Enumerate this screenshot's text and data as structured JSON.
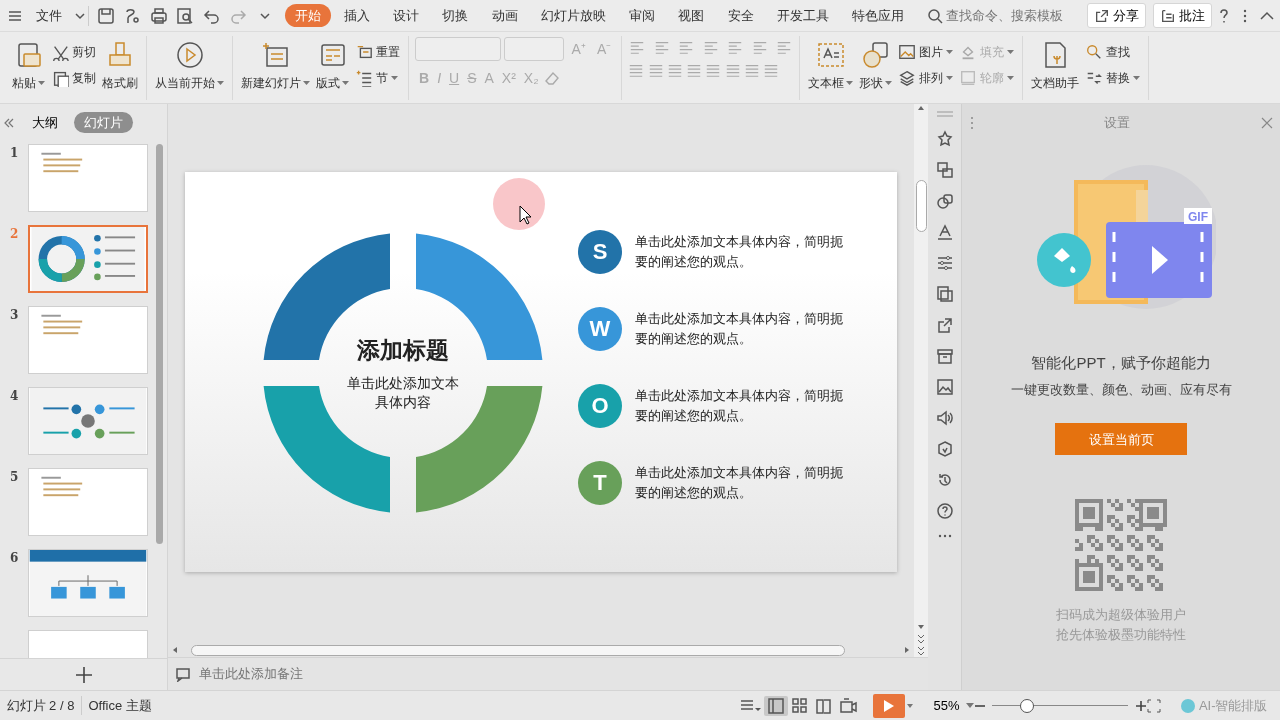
{
  "file_menu": "文件",
  "tabs": [
    {
      "label": "开始",
      "selected": true
    },
    {
      "label": "插入",
      "selected": false
    },
    {
      "label": "设计",
      "selected": false
    },
    {
      "label": "切换",
      "selected": false
    },
    {
      "label": "动画",
      "selected": false
    },
    {
      "label": "幻灯片放映",
      "selected": false
    },
    {
      "label": "审阅",
      "selected": false
    },
    {
      "label": "视图",
      "selected": false
    },
    {
      "label": "安全",
      "selected": false
    },
    {
      "label": "开发工具",
      "selected": false
    },
    {
      "label": "特色应用",
      "selected": false
    }
  ],
  "search": {
    "placeholder": "查找命令、搜索模板"
  },
  "header_buttons": [
    "分享",
    "批注"
  ],
  "ribbon": {
    "groups": [
      {
        "items": [
          {
            "label": "粘贴",
            "kind": "large",
            "caret": true,
            "disabled": false
          },
          {
            "label": "剪切",
            "kind": "small",
            "caret": false,
            "disabled": false
          },
          {
            "label": "复制",
            "kind": "small",
            "caret": false,
            "disabled": false
          },
          {
            "label": "格式刷",
            "kind": "large",
            "caret": false,
            "disabled": false
          }
        ]
      },
      {
        "items": [
          {
            "label": "从当前开始",
            "kind": "large",
            "caret": true,
            "disabled": false
          }
        ]
      },
      {
        "items": [
          {
            "label": "新建幻灯片",
            "kind": "large",
            "caret": true,
            "disabled": false
          },
          {
            "label": "版式",
            "kind": "large",
            "caret": true,
            "disabled": false
          },
          {
            "label": "重置",
            "kind": "small",
            "caret": false,
            "disabled": false
          },
          {
            "label": "节",
            "kind": "small",
            "caret": true,
            "disabled": false
          }
        ]
      },
      {
        "kind": "font",
        "keys": [
          "B",
          "I",
          "U",
          "S",
          "A",
          "X²",
          "X₂"
        ],
        "grow": [
          "A⁺",
          "A⁻"
        ],
        "disabled": true
      },
      {
        "kind": "paragraph"
      },
      {
        "items": [
          {
            "label": "文本框",
            "kind": "large",
            "caret": true,
            "disabled": false
          },
          {
            "label": "形状",
            "kind": "large",
            "caret": true,
            "disabled": false
          },
          {
            "label": "图片",
            "kind": "small",
            "caret": true,
            "disabled": false
          },
          {
            "label": "排列",
            "kind": "small",
            "caret": true,
            "disabled": false
          },
          {
            "label": "填充",
            "kind": "small",
            "caret": true,
            "disabled": true
          },
          {
            "label": "轮廓",
            "kind": "small",
            "caret": true,
            "disabled": true
          }
        ]
      },
      {
        "items": [
          {
            "label": "文档助手",
            "kind": "large",
            "caret": false,
            "disabled": false
          },
          {
            "label": "查找",
            "kind": "small",
            "caret": false,
            "disabled": false
          },
          {
            "label": "替换",
            "kind": "small",
            "caret": true,
            "disabled": false
          }
        ]
      }
    ]
  },
  "panel_tabs": [
    {
      "label": "大纲",
      "selected": false
    },
    {
      "label": "幻灯片",
      "selected": true
    }
  ],
  "slides": [
    {
      "number": "1",
      "kind": "text",
      "selected": false
    },
    {
      "number": "2",
      "kind": "donut",
      "selected": true
    },
    {
      "number": "3",
      "kind": "text",
      "selected": false
    },
    {
      "number": "4",
      "kind": "diagram",
      "selected": false
    },
    {
      "number": "5",
      "kind": "text",
      "selected": false
    },
    {
      "number": "6",
      "kind": "banner",
      "selected": false
    },
    {
      "kind": "blank",
      "selected": false
    }
  ],
  "slide": {
    "title": "添加标题",
    "subtitle": "单击此处添加文本具体内容",
    "points": [
      {
        "letter": "S",
        "color": "#2273a9",
        "text": "单击此处添加文本具体内容，简明扼要的阐述您的观点。"
      },
      {
        "letter": "W",
        "color": "#3796d9",
        "text": "单击此处添加文本具体内容，简明扼要的阐述您的观点。"
      },
      {
        "letter": "O",
        "color": "#18a1aa",
        "text": "单击此处添加文本具体内容，简明扼要的阐述您的观点。"
      },
      {
        "letter": "T",
        "color": "#68a05a",
        "text": "单击此处添加文本具体内容，简明扼要的阐述您的观点。"
      }
    ]
  },
  "notes": {
    "placeholder": "单击此处添加备注"
  },
  "right_panel": {
    "title": "设置",
    "badge": "GIF",
    "headline": "智能化PPT，赋予你超能力",
    "subline": "一键更改数量、颜色、动画、应有尽有",
    "action": "设置当前页",
    "caption": [
      "扫码成为超级体验用户",
      "抢先体验极墨功能特性"
    ]
  },
  "status_bar": {
    "slide_counter": "幻灯片 2 / 8",
    "theme": "Office 主题",
    "views": [
      {
        "selected": false
      },
      {
        "selected": true
      },
      {
        "selected": false
      },
      {
        "selected": false
      },
      {
        "selected": false
      }
    ],
    "zoom": "55%",
    "ai_layout": "AI-智能排版"
  }
}
